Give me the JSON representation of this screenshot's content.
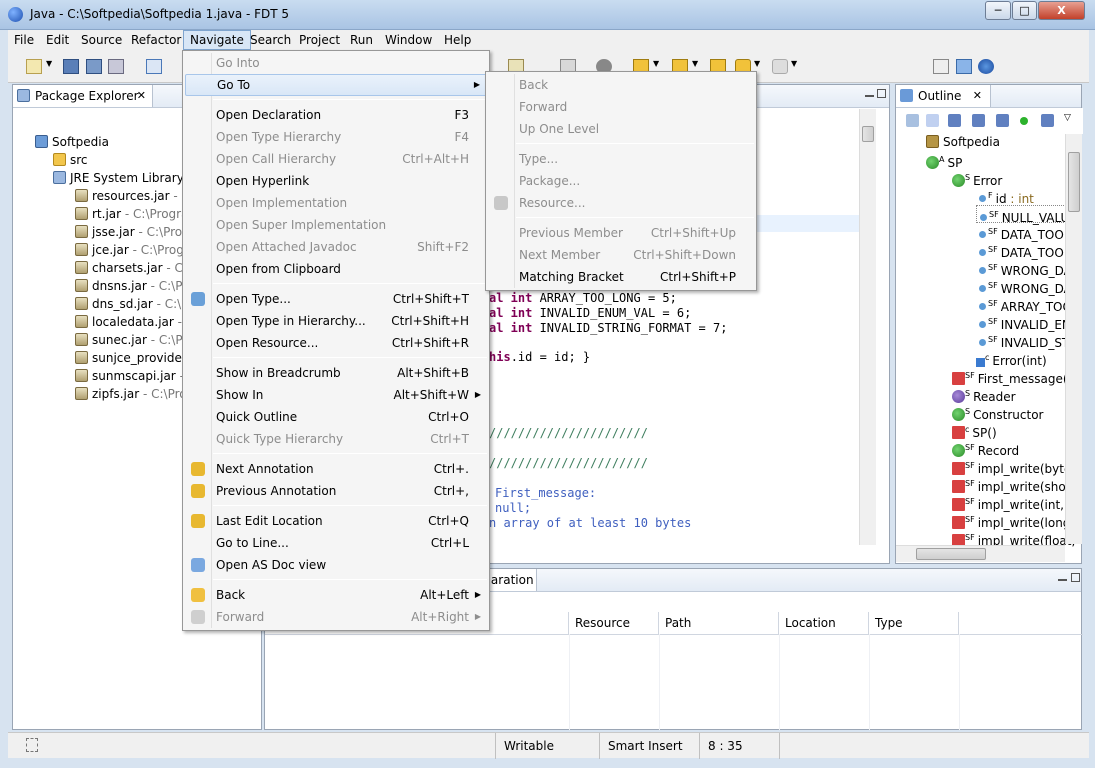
{
  "window": {
    "title": "Java - C:\\Softpedia\\Softpedia 1.java - FDT 5",
    "minimize": "─",
    "maximize": "□",
    "close": "X"
  },
  "menubar": [
    "File",
    "Edit",
    "Source",
    "Refactor",
    "Navigate",
    "Search",
    "Project",
    "Run",
    "Window",
    "Help"
  ],
  "package_explorer": {
    "title": "Package Explorer",
    "close": "✕",
    "items": [
      {
        "label": "Softpedia",
        "suffix": "",
        "icon": "project-icon"
      },
      {
        "label": "src",
        "suffix": "",
        "icon": "package-folder-icon"
      },
      {
        "label": "JRE System Library",
        "suffix": " [",
        "icon": "library-icon"
      },
      {
        "label": "resources.jar",
        "suffix": " - C",
        "icon": "jar-icon"
      },
      {
        "label": "rt.jar",
        "suffix": " - C:\\Progra",
        "icon": "jar-icon"
      },
      {
        "label": "jsse.jar",
        "suffix": " - C:\\Prog",
        "icon": "jar-icon"
      },
      {
        "label": "jce.jar",
        "suffix": " - C:\\Progr",
        "icon": "jar-icon"
      },
      {
        "label": "charsets.jar",
        "suffix": " - C:\\",
        "icon": "jar-icon"
      },
      {
        "label": "dnsns.jar",
        "suffix": " - C:\\Pr",
        "icon": "jar-icon"
      },
      {
        "label": "dns_sd.jar",
        "suffix": " - C:\\P",
        "icon": "jar-icon"
      },
      {
        "label": "localedata.jar",
        "suffix": " - C",
        "icon": "jar-icon"
      },
      {
        "label": "sunec.jar",
        "suffix": " - C:\\Pr",
        "icon": "jar-icon"
      },
      {
        "label": "sunjce_provider.",
        "suffix": "",
        "icon": "jar-icon"
      },
      {
        "label": "sunmscapi.jar",
        "suffix": " - (",
        "icon": "jar-icon"
      },
      {
        "label": "zipfs.jar",
        "suffix": " - C:\\Pro",
        "icon": "jar-icon"
      }
    ]
  },
  "editor": {
    "lines": [
      {
        "kw": "al int ",
        "rest": "ARRAY_TOO_LONG = 5;"
      },
      {
        "kw": "al int ",
        "rest": "INVALID_ENUM_VAL = 6;"
      },
      {
        "kw": "al int ",
        "rest": "INVALID_STRING_FORMAT = 7;"
      },
      {
        "kw": "",
        "rest": ""
      },
      {
        "kw": "his",
        "rest": ".id = id; }"
      }
    ],
    "comment1": "//////////////////////",
    "comment2": "//////////////////////",
    "comment3": "First_message:",
    "comment4": "null;",
    "comment5": "n array of at least 10 bytes"
  },
  "outline": {
    "title": "Outline",
    "close": "✕",
    "items": [
      {
        "label": "Softpedia",
        "type": "",
        "icon": "package-icon",
        "mod": ""
      },
      {
        "label": "SP",
        "type": "",
        "icon": "class-icon",
        "mod": "A"
      },
      {
        "label": "Error",
        "type": "",
        "icon": "class-icon",
        "mod": "S"
      },
      {
        "label": "id",
        "type": " : int",
        "icon": "field-icon",
        "mod": "F"
      },
      {
        "label": "NULL_VALU",
        "type": "",
        "icon": "field-icon",
        "mod": "SF"
      },
      {
        "label": "DATA_TOO",
        "type": "",
        "icon": "field-icon",
        "mod": "SF"
      },
      {
        "label": "DATA_TOO",
        "type": "",
        "icon": "field-icon",
        "mod": "SF"
      },
      {
        "label": "WRONG_DA",
        "type": "",
        "icon": "field-icon",
        "mod": "SF"
      },
      {
        "label": "WRONG_DA",
        "type": "",
        "icon": "field-icon",
        "mod": "SF"
      },
      {
        "label": "ARRAY_TOO",
        "type": "",
        "icon": "field-icon",
        "mod": "SF"
      },
      {
        "label": "INVALID_EN",
        "type": "",
        "icon": "field-icon",
        "mod": "SF"
      },
      {
        "label": "INVALID_ST",
        "type": "",
        "icon": "field-icon",
        "mod": "SF"
      },
      {
        "label": "Error(int)",
        "type": "",
        "icon": "constructor-icon",
        "mod": "c"
      },
      {
        "label": "First_message(by",
        "type": "",
        "icon": "method-icon",
        "mod": "SF"
      },
      {
        "label": "Reader",
        "type": "",
        "icon": "interface-icon",
        "mod": "S"
      },
      {
        "label": "Constructor",
        "type": "",
        "icon": "class-icon",
        "mod": "S"
      },
      {
        "label": "SP()",
        "type": "",
        "icon": "method-icon",
        "mod": "c"
      },
      {
        "label": "Record",
        "type": "",
        "icon": "class-icon",
        "mod": "SF"
      },
      {
        "label": "impl_write(byte,",
        "type": "",
        "icon": "method-icon",
        "mod": "SF"
      },
      {
        "label": "impl_write(short",
        "type": "",
        "icon": "method-icon",
        "mod": "SF"
      },
      {
        "label": "impl_write(int, b",
        "type": "",
        "icon": "method-icon",
        "mod": "SF"
      },
      {
        "label": "impl_write(long,",
        "type": "",
        "icon": "method-icon",
        "mod": "SF"
      },
      {
        "label": "impl_write(float,",
        "type": "",
        "icon": "method-icon",
        "mod": "SF"
      }
    ]
  },
  "bottom": {
    "tab": "claration",
    "columns": [
      "Resource",
      "Path",
      "Location",
      "Type"
    ]
  },
  "status": {
    "writable": "Writable",
    "insert": "Smart Insert",
    "position": "8 : 35"
  },
  "navigate_menu": [
    {
      "label": "Go Into",
      "acc": "",
      "dis": true,
      "sub": false
    },
    {
      "label": "Go To",
      "acc": "",
      "dis": false,
      "sub": true,
      "hl": true
    },
    {
      "sep": true
    },
    {
      "label": "Open Declaration",
      "acc": "F3",
      "dis": false
    },
    {
      "label": "Open Type Hierarchy",
      "acc": "F4",
      "dis": true
    },
    {
      "label": "Open Call Hierarchy",
      "acc": "Ctrl+Alt+H",
      "dis": true
    },
    {
      "label": "Open Hyperlink",
      "acc": "",
      "dis": false
    },
    {
      "label": "Open Implementation",
      "acc": "",
      "dis": true
    },
    {
      "label": "Open Super Implementation",
      "acc": "",
      "dis": true
    },
    {
      "label": "Open Attached Javadoc",
      "acc": "Shift+F2",
      "dis": true
    },
    {
      "label": "Open from Clipboard",
      "acc": "",
      "dis": false
    },
    {
      "sep": true
    },
    {
      "label": "Open Type...",
      "acc": "Ctrl+Shift+T",
      "dis": false,
      "icon": "open-type-icon"
    },
    {
      "label": "Open Type in Hierarchy...",
      "acc": "Ctrl+Shift+H",
      "dis": false
    },
    {
      "label": "Open Resource...",
      "acc": "Ctrl+Shift+R",
      "dis": false
    },
    {
      "sep": true
    },
    {
      "label": "Show in Breadcrumb",
      "acc": "Alt+Shift+B",
      "dis": false
    },
    {
      "label": "Show In",
      "acc": "Alt+Shift+W",
      "dis": false,
      "sub": true
    },
    {
      "label": "Quick Outline",
      "acc": "Ctrl+O",
      "dis": false
    },
    {
      "label": "Quick Type Hierarchy",
      "acc": "Ctrl+T",
      "dis": true
    },
    {
      "sep": true
    },
    {
      "label": "Next Annotation",
      "acc": "Ctrl+.",
      "dis": false,
      "icon": "next-annotation-icon"
    },
    {
      "label": "Previous Annotation",
      "acc": "Ctrl+,",
      "dis": false,
      "icon": "previous-annotation-icon"
    },
    {
      "sep": true
    },
    {
      "label": "Last Edit Location",
      "acc": "Ctrl+Q",
      "dis": false,
      "icon": "last-edit-icon"
    },
    {
      "label": "Go to Line...",
      "acc": "Ctrl+L",
      "dis": false
    },
    {
      "label": "Open AS Doc view",
      "acc": "",
      "dis": false,
      "icon": "asdoc-icon"
    },
    {
      "sep": true
    },
    {
      "label": "Back",
      "acc": "Alt+Left",
      "dis": false,
      "sub": true,
      "icon": "back-arrow-icon"
    },
    {
      "label": "Forward",
      "acc": "Alt+Right",
      "dis": true,
      "sub": true,
      "icon": "forward-arrow-icon"
    }
  ],
  "goto_menu": [
    {
      "label": "Back",
      "acc": "",
      "dis": true
    },
    {
      "label": "Forward",
      "acc": "",
      "dis": true
    },
    {
      "label": "Up One Level",
      "acc": "",
      "dis": true
    },
    {
      "sep": true
    },
    {
      "label": "Type...",
      "acc": "",
      "dis": true
    },
    {
      "label": "Package...",
      "acc": "",
      "dis": true
    },
    {
      "label": "Resource...",
      "acc": "",
      "dis": true,
      "icon": "resource-icon"
    },
    {
      "sep": true
    },
    {
      "label": "Previous Member",
      "acc": "Ctrl+Shift+Up",
      "dis": true
    },
    {
      "label": "Next Member",
      "acc": "Ctrl+Shift+Down",
      "dis": true
    },
    {
      "label": "Matching Bracket",
      "acc": "Ctrl+Shift+P",
      "dis": false
    }
  ]
}
